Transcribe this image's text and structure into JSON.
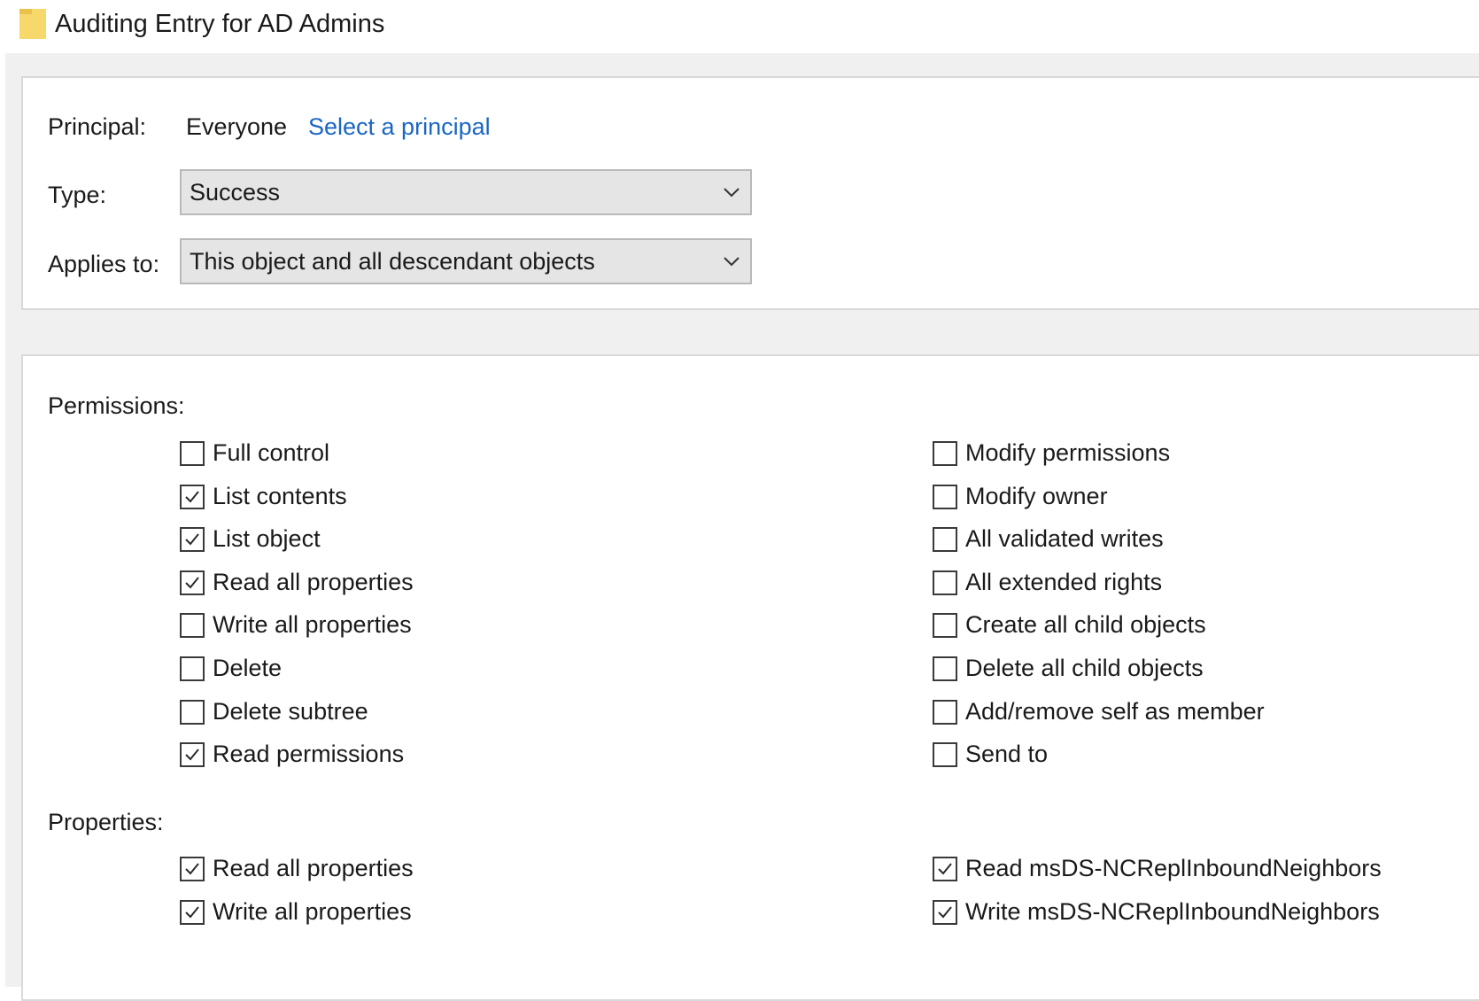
{
  "window": {
    "title": "Auditing Entry for AD Admins",
    "icon": "folder-icon"
  },
  "principal": {
    "label": "Principal:",
    "value": "Everyone",
    "link": "Select a principal"
  },
  "type": {
    "label": "Type:",
    "selected": "Success"
  },
  "applies_to": {
    "label": "Applies to:",
    "selected": "This object and all descendant objects"
  },
  "permissions": {
    "label": "Permissions:",
    "left": [
      {
        "label": "Full control",
        "checked": false
      },
      {
        "label": "List contents",
        "checked": true
      },
      {
        "label": "List object",
        "checked": true
      },
      {
        "label": "Read all properties",
        "checked": true
      },
      {
        "label": "Write all properties",
        "checked": false
      },
      {
        "label": "Delete",
        "checked": false
      },
      {
        "label": "Delete subtree",
        "checked": false
      },
      {
        "label": "Read permissions",
        "checked": true
      }
    ],
    "right": [
      {
        "label": "Modify permissions",
        "checked": false
      },
      {
        "label": "Modify owner",
        "checked": false
      },
      {
        "label": "All validated writes",
        "checked": false
      },
      {
        "label": "All extended rights",
        "checked": false
      },
      {
        "label": "Create all child objects",
        "checked": false
      },
      {
        "label": "Delete all child objects",
        "checked": false
      },
      {
        "label": "Add/remove self as member",
        "checked": false
      },
      {
        "label": "Send to",
        "checked": false
      }
    ]
  },
  "properties": {
    "label": "Properties:",
    "left": [
      {
        "label": "Read all properties",
        "checked": true
      },
      {
        "label": "Write all properties",
        "checked": true
      }
    ],
    "right": [
      {
        "label": "Read msDS-NCReplInboundNeighbors",
        "checked": true
      },
      {
        "label": "Write msDS-NCReplInboundNeighbors",
        "checked": true
      }
    ]
  }
}
